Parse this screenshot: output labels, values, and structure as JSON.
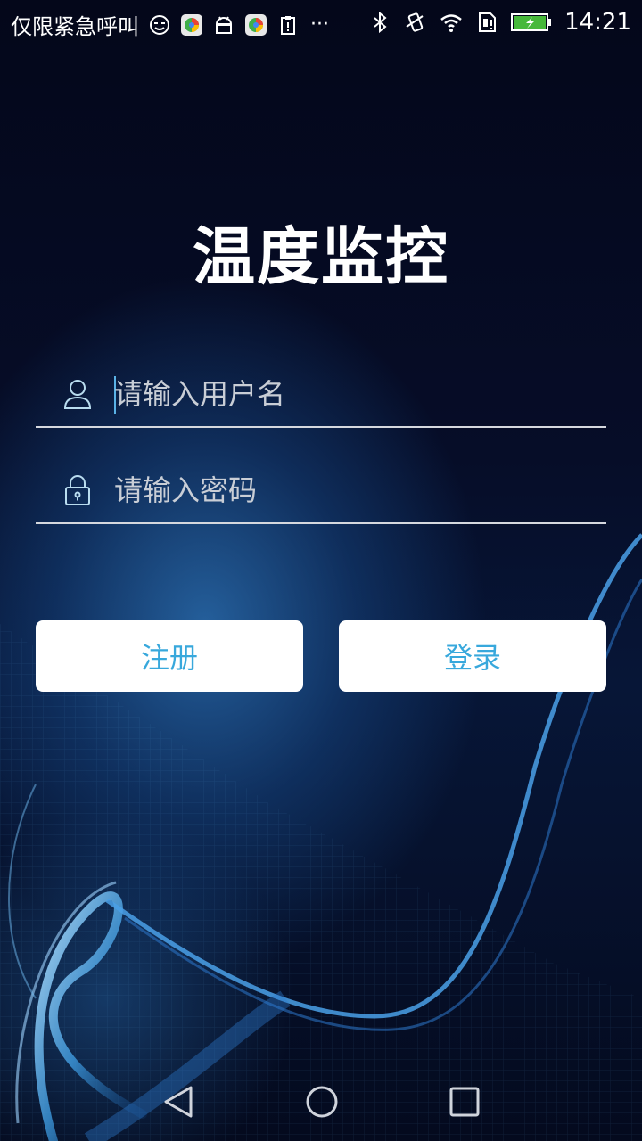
{
  "status_bar": {
    "carrier": "仅限紧急呼叫",
    "time": "14:21",
    "left_icons": [
      "face-icon",
      "app-icon",
      "android-icon",
      "app-icon",
      "clipboard-alert-icon"
    ],
    "overflow": "···",
    "right_icons": [
      "bluetooth-icon",
      "vibrate-icon",
      "wifi-icon",
      "sim-alert-icon",
      "battery-charging-icon"
    ]
  },
  "app": {
    "title": "温度监控"
  },
  "form": {
    "username_placeholder": "请输入用户名",
    "username_value": "",
    "password_placeholder": "请输入密码",
    "password_value": ""
  },
  "buttons": {
    "register": "注册",
    "login": "登录"
  },
  "colors": {
    "accent": "#38a8dc",
    "background": "#060d28",
    "button_bg": "#ffffff"
  },
  "nav": {
    "icons": [
      "back-icon",
      "home-icon",
      "recent-apps-icon"
    ]
  }
}
